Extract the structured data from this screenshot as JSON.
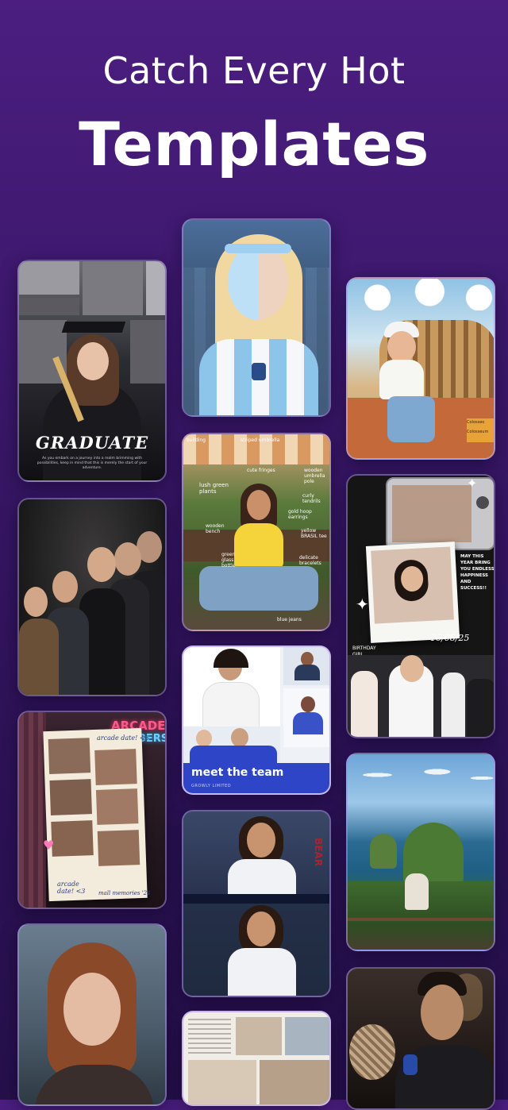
{
  "header": {
    "line1": "Catch Every Hot",
    "line2": "Templates"
  },
  "templates": {
    "graduate": {
      "title": "GRADUATE",
      "caption": "As you embark on a journey into a realm brimming with possibilities, keep in mind that this is merely the start of your adventure."
    },
    "annotated": {
      "notes": [
        "building",
        "striped umbrella",
        "cute fringes",
        "wooden umbrella pole",
        "lush green plants",
        "curly tendrils",
        "gold hoop earrings",
        "yellow BRASIL tee",
        "wooden bench",
        "green glass bottle",
        "delicate bracelets",
        "blue jeans"
      ]
    },
    "team": {
      "title": "meet the team",
      "subtitle": "GROWLY LIMITED"
    },
    "photobooth": {
      "sign": "ARCADE",
      "sign2": "BERS",
      "note1": "arcade date! <3",
      "note2": "arcade date! <3",
      "note3": "mall memories '24"
    },
    "birthday": {
      "message": "MAY THIS YEAR BRING YOU ENDLESS HAPPINESS AND SUCCESS!!",
      "date": "16/08/25",
      "tag": "BIRTHDAY GIRL"
    },
    "colosseum": {
      "sign1": "Colosseo",
      "sign2": "Colosseum"
    },
    "baseball": {
      "jersey": "BEAR"
    }
  },
  "colors": {
    "background_top": "#4b1e80",
    "background_bottom": "#26104b",
    "card_border": "#aa8ceb",
    "team_banner": "#2f45c8"
  }
}
